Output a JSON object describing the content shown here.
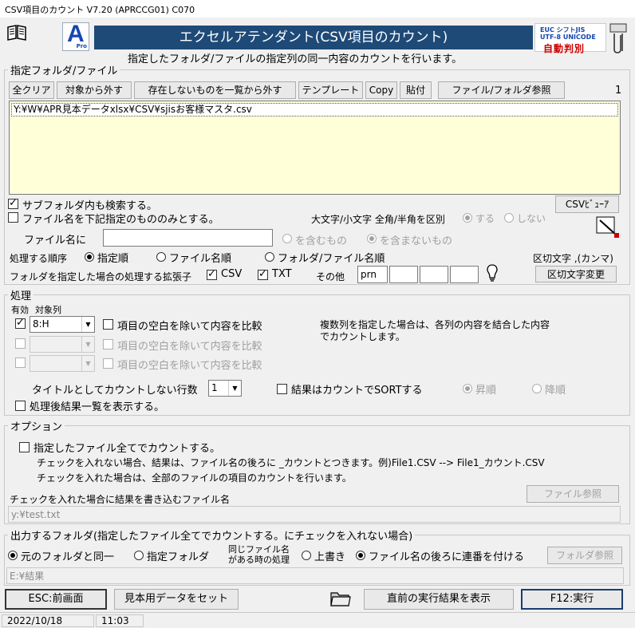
{
  "window": {
    "title": "CSV項目のカウント V7.20 (APRCCG01)  C070"
  },
  "header": {
    "logo_letter": "A",
    "logo_sub": "Pro",
    "banner_title": "エクセルアテンダント(CSV項目のカウント)",
    "encoding_line1": "EUC  シフトJIS",
    "encoding_line2": "UTF-8 UNICODE",
    "encoding_line3": "自動判別",
    "subtitle": "指定したフォルダ/ファイルの指定列の同一内容のカウントを行います。"
  },
  "files_group": {
    "legend": "指定フォルダ/ファイル",
    "toolbar": {
      "clear_all": "全クリア",
      "remove_target": "対象から外す",
      "remove_missing": "存在しないものを一覧から外す",
      "template": "テンプレート",
      "copy": "Copy",
      "paste": "貼付",
      "browse": "ファイル/フォルダ参照"
    },
    "count": "1",
    "file_list": [
      "Y:¥W¥APR見本データxlsx¥CSV¥sjisお客様マスタ.csv"
    ],
    "subfolder_label": "サブフォルダ内も検索する。",
    "csv_viewer": "CSVﾋﾞｭｰｱ",
    "name_filter_label": "ファイル名を下記指定のもののみとする。",
    "case_label": "大文字/小文字 全角/半角を区別",
    "case_yes": "する",
    "case_no": "しない",
    "filename_label": "ファイル名に",
    "filename_value": "",
    "contains": "を含むもの",
    "not_contains": "を含まないもの",
    "order_label": "処理する順序",
    "order_specified": "指定順",
    "order_filename": "ファイル名順",
    "order_folder_file": "フォルダ/ファイル名順",
    "delimiter_label": "区切文字 ,(カンマ)",
    "ext_label": "フォルダを指定した場合の処理する拡張子",
    "ext_csv": "CSV",
    "ext_txt": "TXT",
    "ext_other_label": "その他",
    "ext_other_values": [
      "prn",
      "",
      "",
      ""
    ],
    "delimiter_button": "区切文字変更"
  },
  "process_group": {
    "legend": "処理",
    "enabled_header": "有効",
    "column_header": "対象列",
    "rows": [
      {
        "enabled": true,
        "column": "8:H",
        "trim_label": "項目の空白を除いて内容を比較"
      },
      {
        "enabled": false,
        "column": "",
        "trim_label": "項目の空白を除いて内容を比較"
      },
      {
        "enabled": false,
        "column": "",
        "trim_label": "項目の空白を除いて内容を比較"
      }
    ],
    "multi_note_1": "複数列を指定した場合は、各列の内容を結合した内容",
    "multi_note_2": "でカウントします。",
    "skip_rows_label": "タイトルとしてカウントしない行数",
    "skip_rows_value": "1",
    "sort_label": "結果はカウントでSORTする",
    "asc": "昇順",
    "desc": "降順",
    "show_result_label": "処理後結果一覧を表示する。"
  },
  "options_group": {
    "legend": "オプション",
    "all_files_label": "指定したファイル全てでカウントする。",
    "note_1": "チェックを入れない場合、結果は、ファイル名の後ろに _カウントとつきます。例)File1.CSV --> File1_カウント.CSV",
    "note_2": "チェックを入れた場合は、全部のファイルの項目のカウントを行います。",
    "browse_file": "ファイル参照",
    "output_file_label": "チェックを入れた場合に結果を書き込むファイル名",
    "output_file_value": "y:¥test.txt"
  },
  "output_group": {
    "legend": "出力するフォルダ(指定したファイル全てでカウントする。にチェックを入れない場合)",
    "same_folder": "元のフォルダと同一",
    "specified_folder": "指定フォルダ",
    "same_name_label_1": "同じファイル名",
    "same_name_label_2": "がある時の処理",
    "overwrite": "上書き",
    "append_number": "ファイル名の後ろに連番を付ける",
    "browse_folder": "フォルダ参照",
    "folder_value": "E:¥結果"
  },
  "bottom": {
    "esc": "ESC:前画面",
    "sample": "見本用データをセット",
    "show_last": "直前の実行結果を表示",
    "run": "F12:実行"
  },
  "status": {
    "date": "2022/10/18",
    "time": "11:03"
  }
}
